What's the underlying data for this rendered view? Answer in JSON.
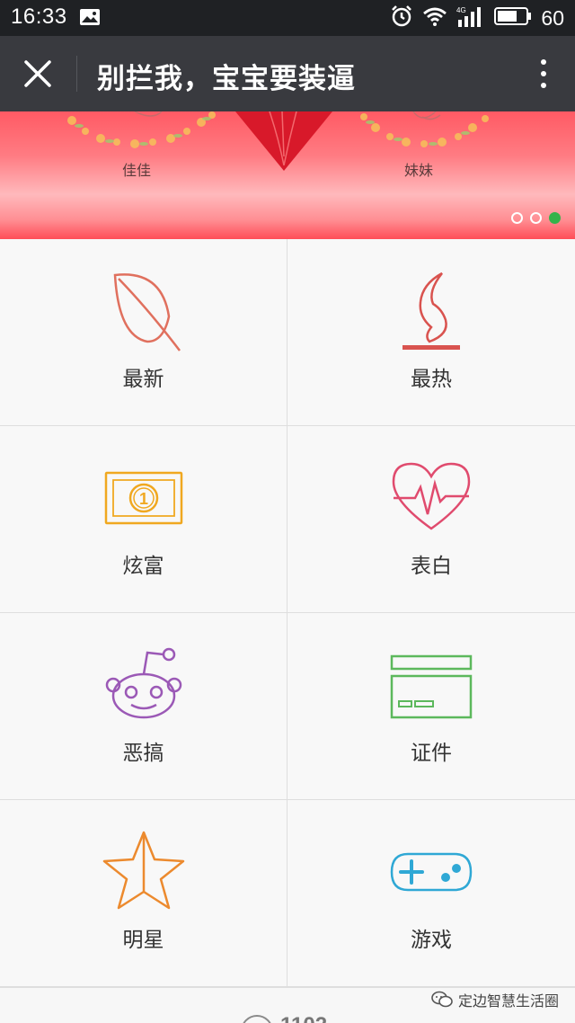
{
  "status_bar": {
    "time": "16:33",
    "battery": "60",
    "network": "4G"
  },
  "title_bar": {
    "title": "别拦我，宝宝要装逼",
    "close_icon": "close-icon",
    "more_icon": "more-vertical-icon"
  },
  "banner": {
    "left_name": "佳佳",
    "right_name": "妹妹",
    "slides": 3,
    "active_slide": 3,
    "accent": "#35b34a"
  },
  "grid": {
    "items": [
      {
        "label": "最新",
        "icon": "leaf-icon",
        "color": "#e0705e"
      },
      {
        "label": "最热",
        "icon": "flame-icon",
        "color": "#d9534f"
      },
      {
        "label": "炫富",
        "icon": "banknote-icon",
        "color": "#f0a820"
      },
      {
        "label": "表白",
        "icon": "heartbeat-icon",
        "color": "#e04b6e"
      },
      {
        "label": "恶搞",
        "icon": "alien-face-icon",
        "color": "#9b59b6"
      },
      {
        "label": "证件",
        "icon": "id-card-icon",
        "color": "#5cb85c"
      },
      {
        "label": "明星",
        "icon": "star-icon",
        "color": "#ec8a2e"
      },
      {
        "label": "游戏",
        "icon": "gamepad-icon",
        "color": "#2fa8d5"
      }
    ]
  },
  "bottom": {
    "partial_text": "1102"
  },
  "watermark": {
    "text": "定边智慧生活圈",
    "icon": "wechat-icon"
  }
}
